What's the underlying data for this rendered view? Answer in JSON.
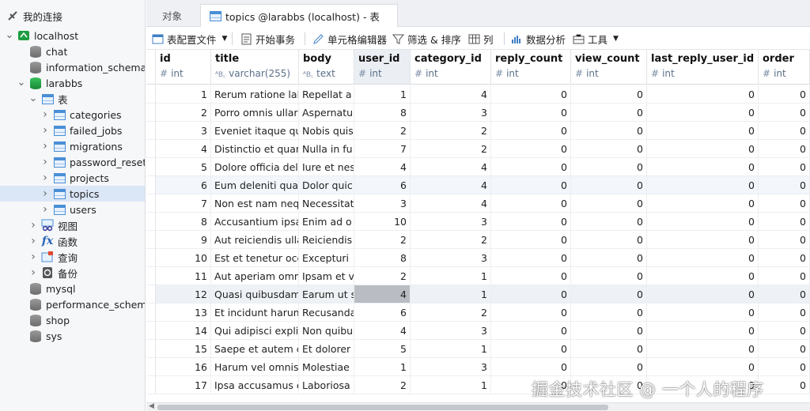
{
  "sidebar": {
    "root_label": "我的连接",
    "items": [
      {
        "label": "localhost",
        "kind": "conn",
        "caret": "v"
      },
      {
        "label": "chat",
        "kind": "db"
      },
      {
        "label": "information_schema",
        "kind": "db"
      },
      {
        "label": "larabbs",
        "kind": "db-open",
        "caret": "v"
      },
      {
        "label": "表",
        "kind": "folder-tables",
        "caret": "v"
      },
      {
        "label": "categories",
        "kind": "table",
        "caret": ">"
      },
      {
        "label": "failed_jobs",
        "kind": "table",
        "caret": ">"
      },
      {
        "label": "migrations",
        "kind": "table",
        "caret": ">"
      },
      {
        "label": "password_resets",
        "kind": "table",
        "caret": ">"
      },
      {
        "label": "projects",
        "kind": "table",
        "caret": ">"
      },
      {
        "label": "topics",
        "kind": "table",
        "caret": ">",
        "selected": true
      },
      {
        "label": "users",
        "kind": "table",
        "caret": ">"
      },
      {
        "label": "视图",
        "kind": "views",
        "caret": ">"
      },
      {
        "label": "函数",
        "kind": "functions",
        "caret": ">"
      },
      {
        "label": "查询",
        "kind": "queries",
        "caret": ">"
      },
      {
        "label": "备份",
        "kind": "backups",
        "caret": ">"
      },
      {
        "label": "mysql",
        "kind": "db"
      },
      {
        "label": "performance_schema",
        "kind": "db"
      },
      {
        "label": "shop",
        "kind": "db"
      },
      {
        "label": "sys",
        "kind": "db"
      }
    ]
  },
  "tabs": [
    {
      "label": "对象"
    },
    {
      "label": "topics @larabbs (localhost) - 表",
      "active": true
    }
  ],
  "toolbar": {
    "profile": "表配置文件",
    "begin_tx": "开始事务",
    "cell_editor": "单元格编辑器",
    "filter_sort": "筛选 & 排序",
    "columns": "列",
    "analysis": "数据分析",
    "tools": "工具"
  },
  "columns": [
    {
      "name": "id",
      "type": "int",
      "icon": "#"
    },
    {
      "name": "title",
      "type": "varchar(255)",
      "icon": "ᴬB꜀"
    },
    {
      "name": "body",
      "type": "text",
      "icon": "ᴬB꜀"
    },
    {
      "name": "user_id",
      "type": "int",
      "icon": "#"
    },
    {
      "name": "category_id",
      "type": "int",
      "icon": "#"
    },
    {
      "name": "reply_count",
      "type": "int",
      "icon": "#"
    },
    {
      "name": "view_count",
      "type": "int",
      "icon": "#"
    },
    {
      "name": "last_reply_user_id",
      "type": "int",
      "icon": "#"
    },
    {
      "name": "order",
      "type": "int",
      "icon": "#"
    }
  ],
  "rows": [
    [
      "1",
      "Rerum ratione lab",
      "Repellat a",
      "1",
      "4",
      "0",
      "0",
      "0",
      "0"
    ],
    [
      "2",
      "Porro omnis ullar",
      "Aspernatu",
      "8",
      "3",
      "0",
      "0",
      "0",
      "0"
    ],
    [
      "3",
      "Eveniet itaque qu",
      "Nobis quis",
      "2",
      "2",
      "0",
      "0",
      "0",
      "0"
    ],
    [
      "4",
      "Distinctio et quan",
      "Nulla in fu",
      "7",
      "2",
      "0",
      "0",
      "0",
      "0"
    ],
    [
      "5",
      "Dolore officia del",
      "Iure et nes",
      "4",
      "4",
      "0",
      "0",
      "0",
      "0"
    ],
    [
      "6",
      "Eum deleniti quae",
      "Dolor quic",
      "6",
      "4",
      "0",
      "0",
      "0",
      "0"
    ],
    [
      "7",
      "Non est nam neq",
      "Necessitat",
      "3",
      "4",
      "0",
      "0",
      "0",
      "0"
    ],
    [
      "8",
      "Accusantium ipsa",
      "Enim ad o",
      "10",
      "3",
      "0",
      "0",
      "0",
      "0"
    ],
    [
      "9",
      "Aut reiciendis ulla",
      "Reiciendis",
      "2",
      "2",
      "0",
      "0",
      "0",
      "0"
    ],
    [
      "10",
      "Est et tenetur occ",
      "Excepturi ",
      "8",
      "3",
      "0",
      "0",
      "0",
      "0"
    ],
    [
      "11",
      "Aut aperiam omn",
      "Ipsam et v",
      "2",
      "1",
      "0",
      "0",
      "0",
      "0"
    ],
    [
      "12",
      "Quasi quibusdam",
      "Earum ut s",
      "4",
      "1",
      "0",
      "0",
      "0",
      "0"
    ],
    [
      "13",
      "Et incidunt harum",
      "Recusanda",
      "6",
      "2",
      "0",
      "0",
      "0",
      "0"
    ],
    [
      "14",
      "Qui adipisci explic",
      "Non quibu",
      "4",
      "3",
      "0",
      "0",
      "0",
      "0"
    ],
    [
      "15",
      "Saepe et autem c",
      "Et dolorer",
      "5",
      "1",
      "0",
      "0",
      "0",
      "0"
    ],
    [
      "16",
      "Harum vel omnis",
      "Molestiae",
      "1",
      "3",
      "0",
      "0",
      "0",
      "0"
    ],
    [
      "17",
      "Ipsa accusamus e",
      "Laboriosa",
      "2",
      "1",
      "0",
      "0",
      "0",
      "0"
    ]
  ],
  "selected_row_index": 11,
  "alt_row_index": 5,
  "focused_column_index": 3,
  "watermark": "掘金技术社区 @ 一个人的程序",
  "colors": {
    "accent": "#4a8fd6",
    "selection": "#dbe6f7",
    "focus_cell": "#b9bcc2",
    "db_green": "#1f9d42"
  }
}
